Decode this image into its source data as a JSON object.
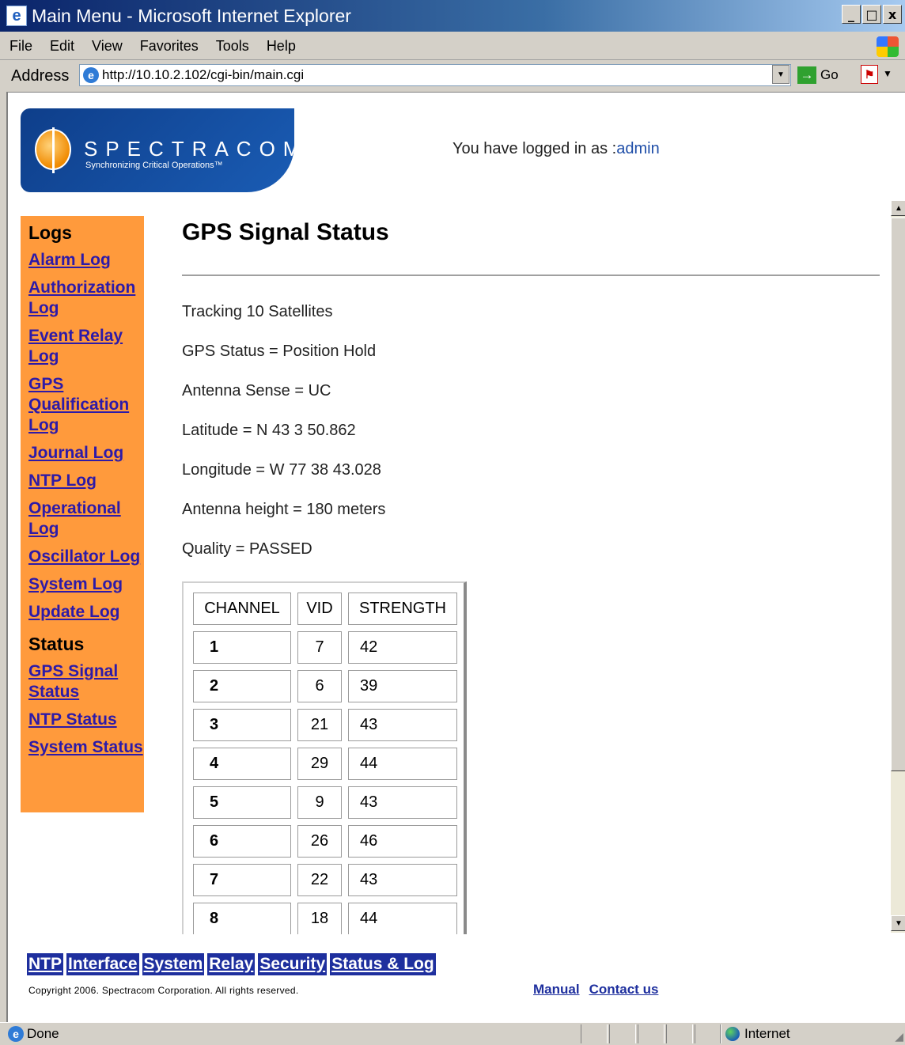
{
  "window": {
    "title": "Main Menu - Microsoft Internet Explorer",
    "controls": [
      "_",
      "□",
      "x"
    ]
  },
  "menubar": [
    "File",
    "Edit",
    "View",
    "Favorites",
    "Tools",
    "Help"
  ],
  "address": {
    "label": "Address",
    "url": "http://10.10.2.102/cgi-bin/main.cgi",
    "go_label": "Go"
  },
  "logo": {
    "name": "SPECTRACOM",
    "tagline": "Synchronizing Critical Operations™"
  },
  "login": {
    "prefix": "You have logged in as :",
    "user": "admin"
  },
  "sidebar": {
    "logs_heading": "Logs",
    "logs": [
      "Alarm Log",
      "Authorization Log",
      "Event Relay Log",
      "GPS Qualification Log",
      "Journal Log",
      "NTP Log",
      "Operational Log",
      "Oscillator Log",
      "System Log",
      "Update Log"
    ],
    "status_heading": "Status",
    "status": [
      "GPS Signal Status",
      "NTP Status",
      "System Status"
    ]
  },
  "main": {
    "title": "GPS Signal Status",
    "info": [
      "Tracking 10 Satellites",
      "GPS Status = Position Hold",
      "Antenna Sense = UC",
      "Latitude = N 43 3 50.862",
      "Longitude = W 77 38 43.028",
      "Antenna height = 180 meters",
      "Quality = PASSED"
    ],
    "table": {
      "headers": [
        "CHANNEL",
        "VID",
        "STRENGTH"
      ],
      "rows": [
        [
          "1",
          "7",
          "42"
        ],
        [
          "2",
          "6",
          "39"
        ],
        [
          "3",
          "21",
          "43"
        ],
        [
          "4",
          "29",
          "44"
        ],
        [
          "5",
          "9",
          "43"
        ],
        [
          "6",
          "26",
          "46"
        ],
        [
          "7",
          "22",
          "43"
        ],
        [
          "8",
          "18",
          "44"
        ]
      ]
    }
  },
  "bottom_nav": [
    "NTP",
    "Interface",
    "System",
    "Relay",
    "Security",
    "Status & Log"
  ],
  "footer": {
    "copyright": "Copyright 2006. Spectracom Corporation. All rights reserved.",
    "manual": "Manual",
    "contact": "Contact us"
  },
  "statusbar": {
    "status": "Done",
    "zone": "Internet"
  }
}
